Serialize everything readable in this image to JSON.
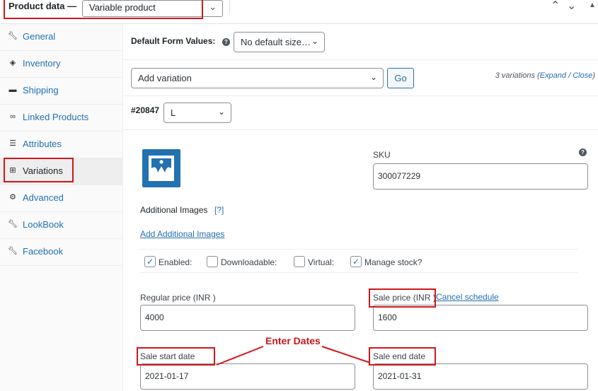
{
  "header": {
    "title": "Product data —",
    "product_type": "Variable product"
  },
  "sidebar": {
    "items": [
      {
        "label": "General",
        "icon": "wrench-icon"
      },
      {
        "label": "Inventory",
        "icon": "tag-icon"
      },
      {
        "label": "Shipping",
        "icon": "truck-icon"
      },
      {
        "label": "Linked Products",
        "icon": "link-icon"
      },
      {
        "label": "Attributes",
        "icon": "list-icon"
      },
      {
        "label": "Variations",
        "icon": "grid-icon",
        "active": true
      },
      {
        "label": "Advanced",
        "icon": "gear-icon"
      },
      {
        "label": "LookBook",
        "icon": "wrench-icon"
      },
      {
        "label": "Facebook",
        "icon": "wrench-icon"
      }
    ]
  },
  "defaults": {
    "label": "Default Form Values:",
    "size_value": "No default size…"
  },
  "add_variation": {
    "select_value": "Add variation",
    "go_label": "Go",
    "count_text": "3 variations (",
    "expand_label": "Expand",
    "separator": " / ",
    "close_label": "Close",
    "count_end": ")"
  },
  "variation": {
    "id": "#20847",
    "size": "L",
    "sku_label": "SKU",
    "sku_value": "300077229",
    "additional_images_label": "Additional Images",
    "additional_images_help": "[?]",
    "add_images_link": "Add Additional Images",
    "options": {
      "enabled": "Enabled:",
      "downloadable": "Downloadable:",
      "virtual": "Virtual:",
      "manage_stock": "Manage stock?"
    },
    "regular_price_label": "Regular price (INR )",
    "regular_price_value": "4000",
    "sale_price_label": "Sale price (INR )",
    "cancel_schedule": "Cancel schedule",
    "sale_price_value": "1600",
    "sale_start_label": "Sale start date",
    "sale_start_value": "2021-01-17",
    "sale_end_label": "Sale end date",
    "sale_end_value": "2021-01-31"
  },
  "annotation": {
    "text": "Enter Dates"
  },
  "colors": {
    "accent": "#2271b1",
    "annotation_red": "#d1171b"
  }
}
